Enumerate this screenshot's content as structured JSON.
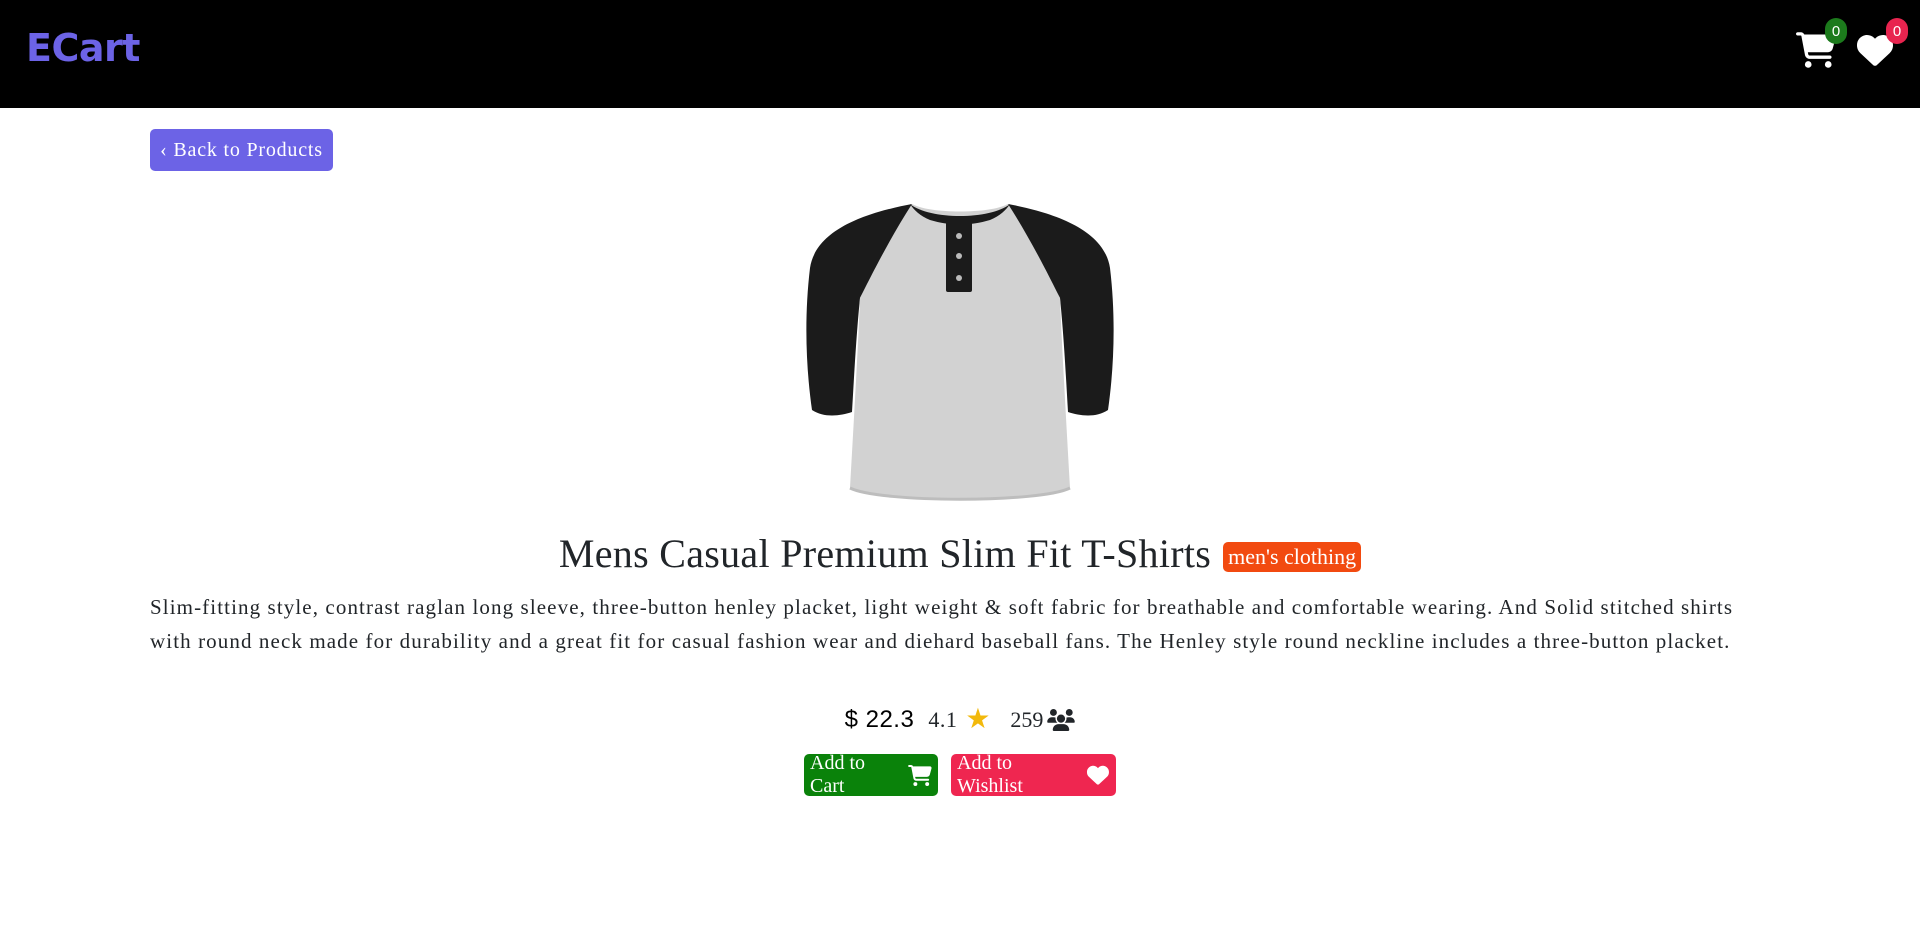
{
  "header": {
    "brand": "ECart",
    "cart_count": "0",
    "wishlist_count": "0"
  },
  "back_button": "‹ Back to Products",
  "product": {
    "title": "Mens Casual Premium Slim Fit T-Shirts",
    "category": "men's clothing",
    "description": "Slim-fitting style, contrast raglan long sleeve, three-button henley placket, light weight & soft fabric for breathable and comfortable wearing. And Solid stitched shirts with round neck made for durability and a great fit for casual fashion wear and diehard baseball fans. The Henley style round neckline includes a three-button placket.",
    "price": "$ 22.3",
    "rating": "4.1",
    "rating_count": "259"
  },
  "actions": {
    "add_to_cart": "Add to Cart",
    "add_to_wishlist": "Add to Wishlist"
  },
  "colors": {
    "brand": "#6c63e6",
    "cart_badge": "#1c7a1c",
    "wishlist_badge": "#e8244f",
    "category_badge": "#f24a10",
    "cart_button": "#0a820a",
    "wishlist_button": "#ef2650",
    "star": "#f2b90c"
  },
  "icons": [
    "cart-icon",
    "heart-icon",
    "star-icon",
    "users-icon"
  ]
}
